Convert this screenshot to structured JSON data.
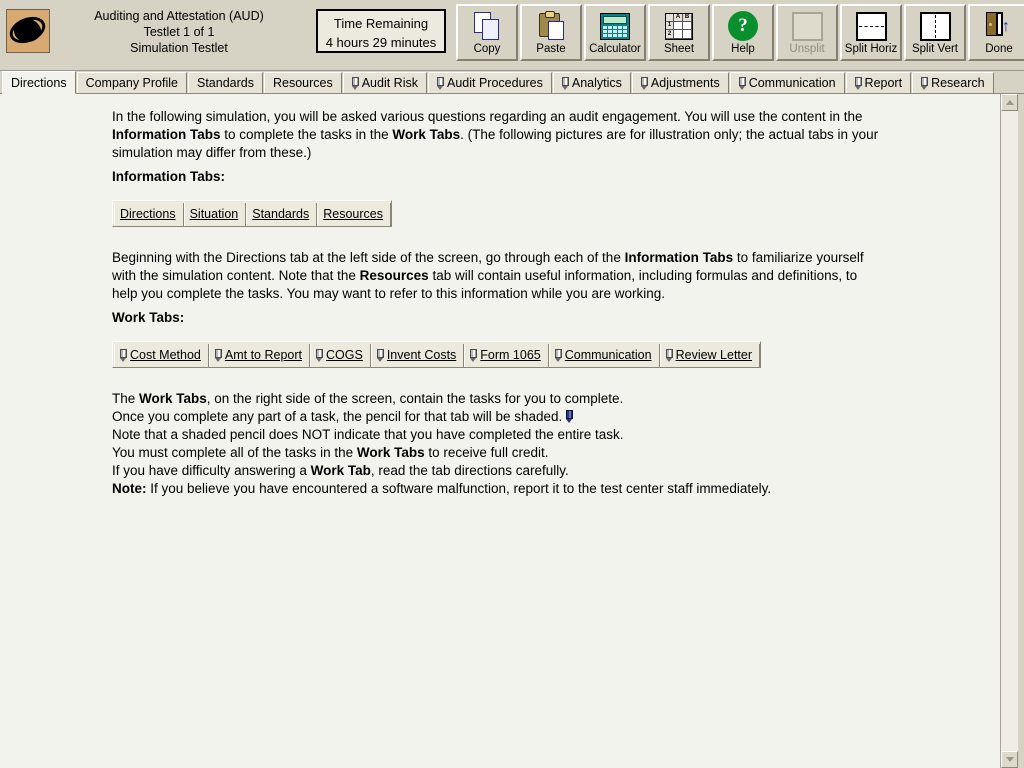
{
  "header": {
    "logo_icon": "planet-logo-icon",
    "exam_title_line1": "Auditing and Attestation (AUD)",
    "exam_title_line2": "Testlet 1 of 1",
    "exam_title_line3": "Simulation Testlet",
    "timer_label": "Time Remaining",
    "timer_value": "4 hours 29 minutes",
    "buttons": [
      {
        "label": "Copy",
        "icon": "copy-icon",
        "disabled": false
      },
      {
        "label": "Paste",
        "icon": "paste-icon",
        "disabled": false
      },
      {
        "label": "Calculator",
        "icon": "calculator-icon",
        "disabled": false
      },
      {
        "label": "Sheet",
        "icon": "spreadsheet-icon",
        "disabled": false
      },
      {
        "label": "Help",
        "icon": "help-icon",
        "disabled": false
      },
      {
        "label": "Unsplit",
        "icon": "unsplit-icon",
        "disabled": true
      },
      {
        "label": "Split Horiz",
        "icon": "split-horiz-icon",
        "disabled": false
      },
      {
        "label": "Split Vert",
        "icon": "split-vert-icon",
        "disabled": false
      },
      {
        "label": "Done",
        "icon": "exit-door-icon",
        "disabled": false
      }
    ],
    "sheet_icon_cells": {
      "col_a": "A",
      "col_b": "B",
      "row_1": "1",
      "row_2": "2"
    },
    "help_icon_glyph": "?",
    "done_icon_arrow": "↑"
  },
  "tabs": [
    {
      "label": "Directions",
      "pencil": false,
      "active": true
    },
    {
      "label": "Company Profile",
      "pencil": false,
      "active": false
    },
    {
      "label": "Standards",
      "pencil": false,
      "active": false
    },
    {
      "label": "Resources",
      "pencil": false,
      "active": false
    },
    {
      "label": "Audit Risk",
      "pencil": true,
      "active": false
    },
    {
      "label": "Audit Procedures",
      "pencil": true,
      "active": false
    },
    {
      "label": "Analytics",
      "pencil": true,
      "active": false
    },
    {
      "label": "Adjustments",
      "pencil": true,
      "active": false
    },
    {
      "label": "Communication",
      "pencil": true,
      "active": false
    },
    {
      "label": "Report",
      "pencil": true,
      "active": false
    },
    {
      "label": "Research",
      "pencil": true,
      "active": false
    }
  ],
  "content": {
    "intro_1": "In the following simulation, you will be asked various questions regarding an audit engagement. You will use the content in the ",
    "intro_b1": "Information Tabs",
    "intro_2": " to complete the tasks in the ",
    "intro_b2": "Work Tabs",
    "intro_3": ".  (The following pictures are for illustration only; the actual tabs in your simulation may differ from these.)",
    "info_heading": "Information Tabs:",
    "info_tabs": [
      {
        "label": "Directions",
        "active": true
      },
      {
        "label": "Situation",
        "active": false
      },
      {
        "label": "Standards",
        "active": false
      },
      {
        "label": "Resources",
        "active": false
      }
    ],
    "para2_1": "Beginning with the Directions tab at the left side of the screen, go through each of the ",
    "para2_b1": "Information Tabs",
    "para2_2": " to familiarize yourself with the simulation content. Note that the ",
    "para2_b2": "Resources",
    "para2_3": " tab will contain useful information, including formulas and definitions, to help you complete the tasks. You may want to refer to this information while you are working.",
    "work_heading": "Work Tabs:",
    "work_tabs": [
      {
        "label": "Cost Method",
        "pencil": true
      },
      {
        "label": "Amt to Report",
        "pencil": true
      },
      {
        "label": "COGS",
        "pencil": true
      },
      {
        "label": "Invent Costs",
        "pencil": true
      },
      {
        "label": "Form 1065",
        "pencil": true
      },
      {
        "label": "Communication",
        "pencil": true
      },
      {
        "label": "Review Letter",
        "pencil": true
      }
    ],
    "para3_1": "The ",
    "para3_b1": "Work Tabs",
    "para3_2": ", on the right side of the screen, contain the tasks for you to complete.",
    "para4_line1": "Once you complete any part of a task, the pencil for that tab will be shaded.",
    "para4_line2": "Note that a shaded pencil does NOT indicate that you have completed the entire task.",
    "para5_1": "You must complete all of the tasks in the ",
    "para5_b1": "Work Tabs",
    "para5_2": " to receive full credit.",
    "para6_1": "If you have difficulty answering a ",
    "para6_b1": "Work Tab",
    "para6_2": ", read the tab directions carefully.",
    "note_label": "Note:",
    "note_text": "  If you believe you have encountered a software malfunction, report it to the test center staff immediately."
  },
  "scrollbar": {
    "up_arrow": "scroll-up-arrow",
    "down_arrow": "scroll-down-arrow"
  },
  "colors": {
    "toolbar_bg": "#d6d3c4",
    "content_bg": "#f2f3ed",
    "logo_bg": "#d8aa72",
    "help_green": "#0a8f2e",
    "shaded_pencil_blue": "#27348b"
  }
}
